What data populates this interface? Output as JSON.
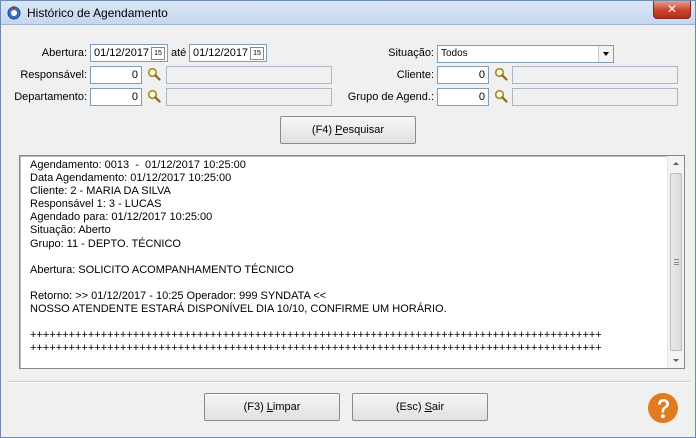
{
  "window": {
    "title": "Histórico de Agendamento",
    "close_label": "✕",
    "icon": "calendar-gear-icon"
  },
  "filters": {
    "abertura_label": "Abertura:",
    "abertura_from": "01/12/2017",
    "ate_label": "até",
    "abertura_to": "01/12/2017",
    "calendar_icon_text": "15",
    "situacao_label": "Situação:",
    "situacao_value": "Todos",
    "responsavel_label": "Responsável:",
    "responsavel_code": "0",
    "responsavel_name": "",
    "cliente_label": "Cliente:",
    "cliente_code": "0",
    "cliente_name": "",
    "departamento_label": "Departamento:",
    "departamento_code": "0",
    "departamento_name": "",
    "grupo_label": "Grupo de Agend.:",
    "grupo_code": "0",
    "grupo_name": ""
  },
  "buttons": {
    "pesquisar_prefix": "(F4) ",
    "pesquisar_key": "P",
    "pesquisar_rest": "esquisar",
    "limpar_prefix": "(F3) ",
    "limpar_key": "L",
    "limpar_rest": "impar",
    "sair_prefix": "(Esc) ",
    "sair_key": "S",
    "sair_rest": "air"
  },
  "memo": {
    "text": "Agendamento: 0013  -  01/12/2017 10:25:00\nData Agendamento: 01/12/2017 10:25:00\nCliente: 2 - MARIA DA SILVA\nResponsável 1: 3 - LUCAS\nAgendado para: 01/12/2017 10:25:00\nSituação: Aberto\nGrupo: 11 - DEPTO. TÉCNICO\n\nAbertura: SOLICITO ACOMPANHAMENTO TÉCNICO\n\nRetorno: >> 01/12/2017 - 10:25 Operador: 999 SYNDATA <<\nNOSSO ATENDENTE ESTARÁ DISPONÍVEL DIA 10/10, CONFIRME UM HORÁRIO.\n\n+++++++++++++++++++++++++++++++++++++++++++++++++++++++++++++++++++++++++++++++++++++++++\n+++++++++++++++++++++++++++++++++++++++++++++++++++++++++++++++++++++++++++++++++++++++++"
  },
  "colors": {
    "help_orange": "#e07b20",
    "titlebar": "#c6d7ee",
    "close_red": "#c7432b"
  }
}
